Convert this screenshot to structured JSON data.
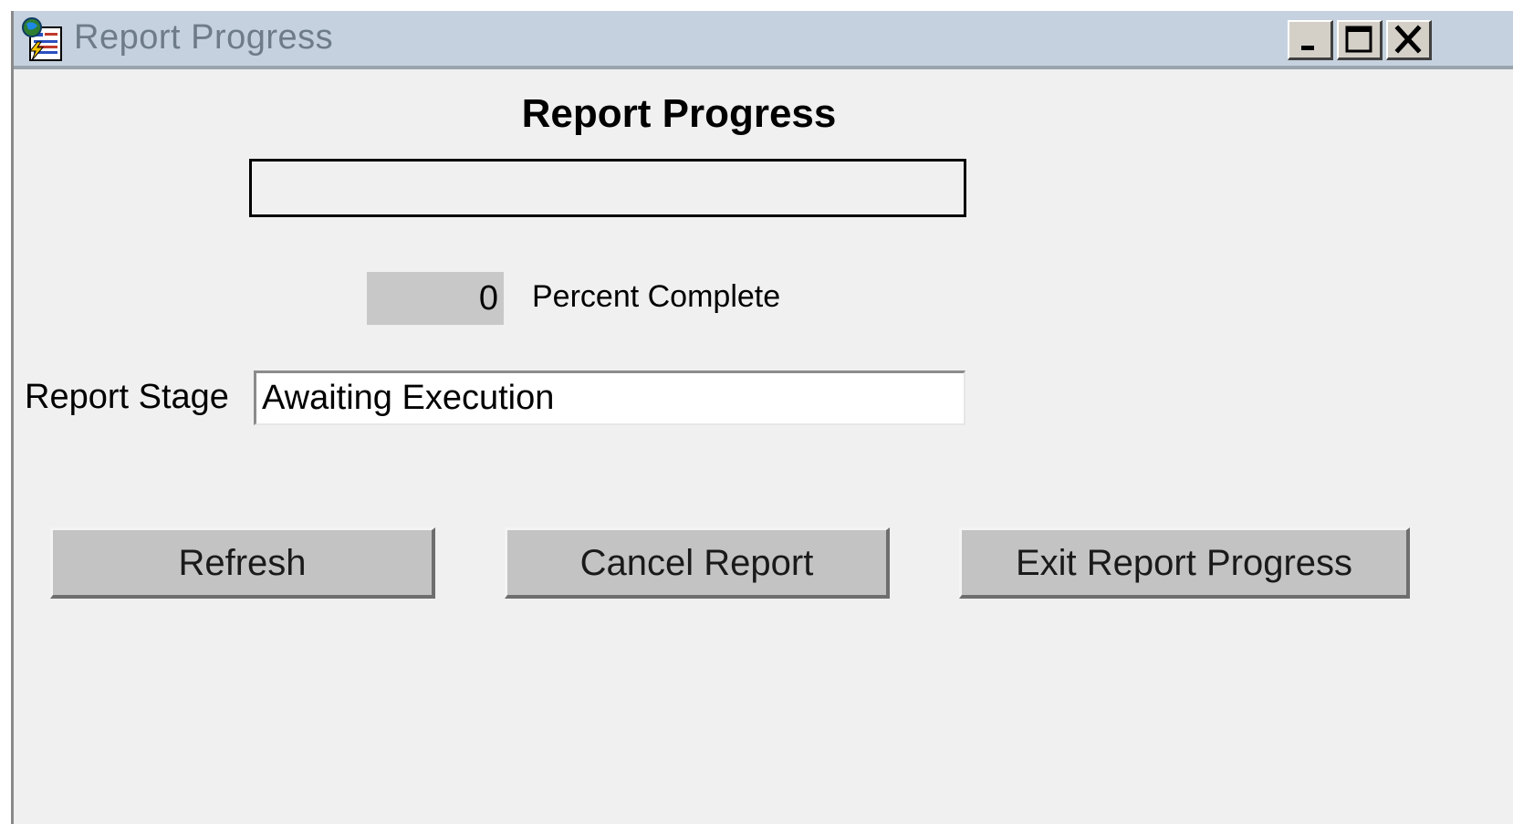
{
  "window": {
    "title": "Report Progress",
    "controls": {
      "minimize_icon": "minimize-icon",
      "maximize_icon": "maximize-icon",
      "close_icon": "close-icon"
    }
  },
  "main": {
    "heading": "Report Progress",
    "progress": {
      "percent_value": "0",
      "percent_fraction": 0,
      "percent_label": "Percent Complete"
    },
    "report_stage": {
      "label": "Report Stage",
      "value": "Awaiting Execution"
    },
    "buttons": {
      "refresh": "Refresh",
      "cancel": "Cancel Report",
      "exit": "Exit Report Progress"
    }
  },
  "colors": {
    "titlebar": "#c5d1de",
    "window_bg": "#f0f0f0",
    "button_face": "#c3c3c3",
    "percent_field_bg": "#c8c8c8"
  }
}
